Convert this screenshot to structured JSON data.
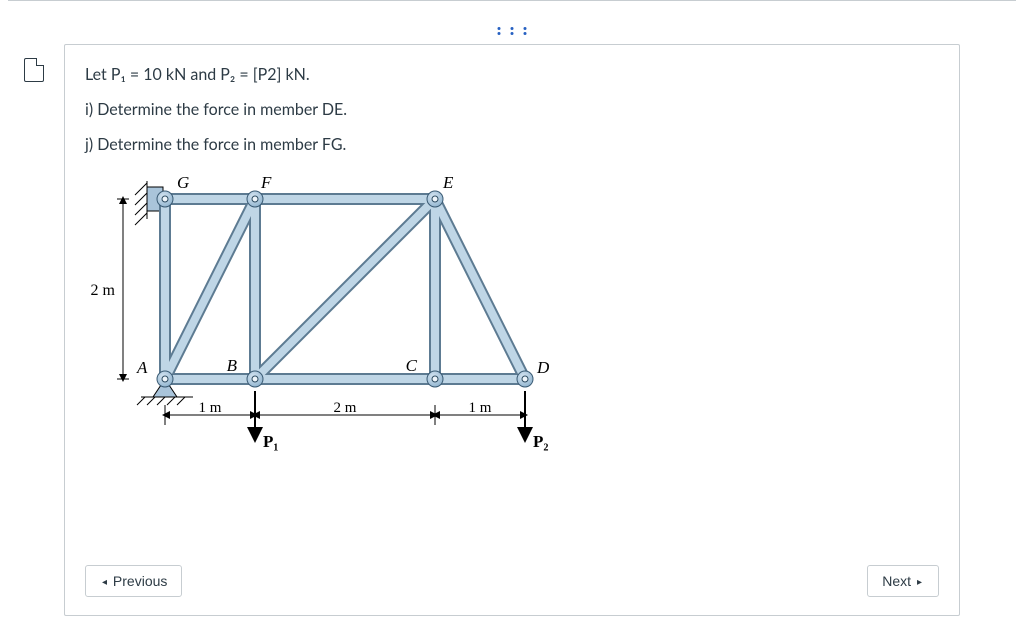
{
  "problem": {
    "given": "Let P₁ = 10 kN and P₂ = [P2] kN.",
    "part_i": "i) Determine the force in member DE.",
    "part_j": "j) Determine the force in member FG."
  },
  "figure": {
    "labels": {
      "G": "G",
      "F": "F",
      "E": "E",
      "A": "A",
      "B": "B",
      "C": "C",
      "D": "D"
    },
    "dims": {
      "height": "2 m",
      "seg_AB": "1 m",
      "seg_BC": "2 m",
      "seg_CD": "1 m"
    },
    "loads": {
      "P1": "P₁",
      "P2": "P₂"
    }
  },
  "nav": {
    "prev": "Previous",
    "next": "Next"
  },
  "chart_data": {
    "type": "truss-diagram",
    "units": "m",
    "nodes": {
      "A": {
        "x": 0,
        "y": 0
      },
      "B": {
        "x": 1,
        "y": 0
      },
      "C": {
        "x": 3,
        "y": 0
      },
      "D": {
        "x": 4,
        "y": 0
      },
      "G": {
        "x": 0,
        "y": 2
      },
      "F": {
        "x": 1,
        "y": 2
      },
      "E": {
        "x": 3,
        "y": 2
      }
    },
    "members": [
      "GA",
      "GF",
      "FE",
      "AB",
      "BC",
      "CD",
      "AF",
      "BF",
      "BE",
      "CE",
      "ED"
    ],
    "supports": {
      "G": "fixed",
      "A": "pin"
    },
    "loads": [
      {
        "at": "B",
        "name": "P1",
        "magnitude_kN": 10,
        "dir": "down"
      },
      {
        "at": "D",
        "name": "P2",
        "magnitude_kN": "[P2]",
        "dir": "down"
      }
    ],
    "dimensions": {
      "height": 2,
      "AB": 1,
      "BC": 2,
      "CD": 1
    }
  }
}
